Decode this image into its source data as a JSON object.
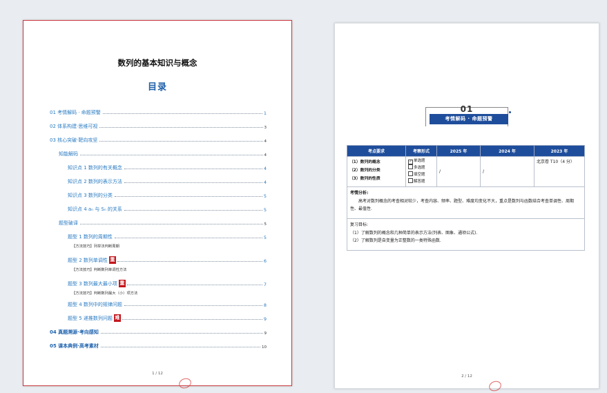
{
  "page1": {
    "doc_title": "数列的基本知识与概念",
    "toc_title": "目录",
    "toc": [
      {
        "label": "01 考情解码 · 命题预警",
        "page": "1",
        "level": 1
      },
      {
        "label": "02 体系构建·思维可视",
        "page": "3",
        "level": 1
      },
      {
        "label": "03 核心突破·靶向攻坚",
        "page": "4",
        "level": 1
      },
      {
        "label": "知能解码",
        "page": "4",
        "level": 2
      },
      {
        "label": "知识点 1  数列的有关概念",
        "page": "4",
        "level": 3
      },
      {
        "label": "知识点 2  数列的表示方法",
        "page": "4",
        "level": 3
      },
      {
        "label": "知识点 3  数列的分类",
        "page": "5",
        "level": 3
      },
      {
        "label": "知识点 4  aₙ 与 Sₙ 的关系",
        "page": "5",
        "level": 3
      },
      {
        "label": "题型破译",
        "page": "5",
        "level": 2
      },
      {
        "label": "题型 1  数列的周期性",
        "page": "5",
        "level": 3
      },
      {
        "label": "题型 2  数列单调性",
        "page": "6",
        "level": 3,
        "badge": "重"
      },
      {
        "label": "题型 3  数列最大最小项",
        "page": "7",
        "level": 3,
        "badge": "重"
      },
      {
        "label": "题型 4  数列中的规律问题",
        "page": "8",
        "level": 3
      },
      {
        "label": "题型 5  递推数列问题",
        "page": "9",
        "level": 3,
        "badge": "难"
      },
      {
        "label": "04 真题溯源·考向感知",
        "page": "9",
        "level": 1,
        "bold": true
      },
      {
        "label": "05 课本典例·高考素材",
        "page": "10",
        "level": 1,
        "bold": true
      }
    ],
    "methods": [
      "【方法技巧】列举法判断周期",
      "【方法技巧】判断数列单调性方法",
      "【方法技巧】判断数列最大（小）项方法"
    ],
    "page_number": "1 / 12"
  },
  "page2": {
    "section_number": "01",
    "section_title": "考情解码 · 命题预警",
    "table": {
      "headers": [
        "考点要求",
        "考察形式",
        "2025 年",
        "2024 年",
        "2023 年"
      ],
      "points": [
        "（1）数列的概念",
        "（2）数列的分类",
        "（3）数列的性质"
      ],
      "forms": [
        {
          "label": "单选题",
          "checked": true
        },
        {
          "label": "多选题",
          "checked": false
        },
        {
          "label": "填空题",
          "checked": false
        },
        {
          "label": "解答题",
          "checked": false
        }
      ],
      "y2025": "/",
      "y2024": "/",
      "y2023": "北京卷 T10（4 分）"
    },
    "analysis_title": "考情分析:",
    "analysis_text": "高考对数列概念的考查相对较少，考查内容、频率、题型、难度均变化不大，重点是数列与函数结合考查单调性、周期性、最值性.",
    "review_title": "复习目标:",
    "review_items": [
      "（1）了解数列的概念和几种简单的表示方法(列表、图象、通项公式).",
      "（2）了解数列是自变量为正整数的一类特殊函数."
    ],
    "page_number": "2 / 12"
  }
}
